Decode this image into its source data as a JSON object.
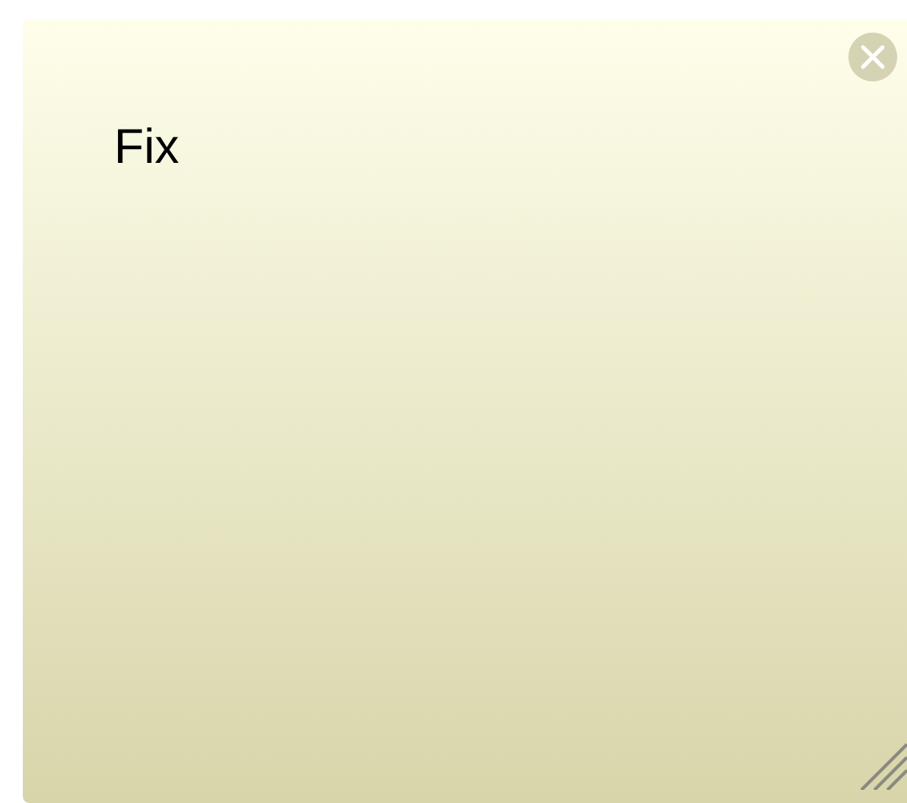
{
  "note": {
    "text": "Fix"
  }
}
